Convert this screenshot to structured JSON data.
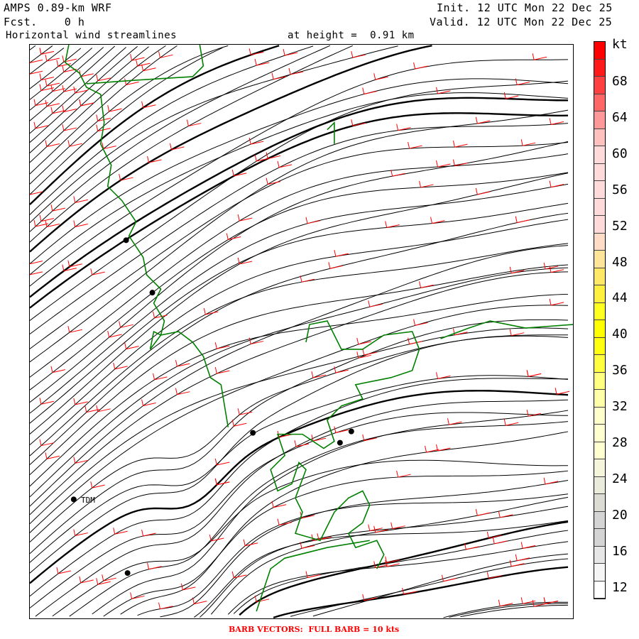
{
  "header": {
    "model": "AMPS 0.89-km WRF",
    "forecast": "Fcst.    0 h",
    "init": "Init. 12 UTC Mon 22 Dec 25",
    "valid": "Valid. 12 UTC Mon 22 Dec 25",
    "field": "Horizontal wind streamlines",
    "height": "at height =  0.91 km"
  },
  "colorbar": {
    "unit": "kt",
    "labels": [
      "68",
      "64",
      "60",
      "56",
      "52",
      "48",
      "44",
      "40",
      "36",
      "32",
      "28",
      "24",
      "20",
      "16",
      "12"
    ],
    "colors": [
      "#ff0000",
      "#ff1a1a",
      "#ff4040",
      "#ff6666",
      "#ff9999",
      "#ffc0c0",
      "#ffdada",
      "#ffdada",
      "#ffdada",
      "#ffdada",
      "#ffdada",
      "#ffdcc8",
      "#ffe599",
      "#ffe866",
      "#fff040",
      "#ffff20",
      "#ffff00",
      "#ffff10",
      "#ffff40",
      "#ffff80",
      "#ffffaa",
      "#ffffcc",
      "#ffffd0",
      "#ffffd0",
      "#f5f5dc",
      "#ebebdc",
      "#dcdcd4",
      "#d4d4d4",
      "#d4d4d4",
      "#e6e6e6",
      "#f5f5f5",
      "#ffffff"
    ]
  },
  "map": {
    "station_label": "TDM",
    "coast_color": "#008000",
    "barb_color": "#ff0000"
  },
  "footer": "BARB VECTORS:  FULL BARB = 10 kts"
}
